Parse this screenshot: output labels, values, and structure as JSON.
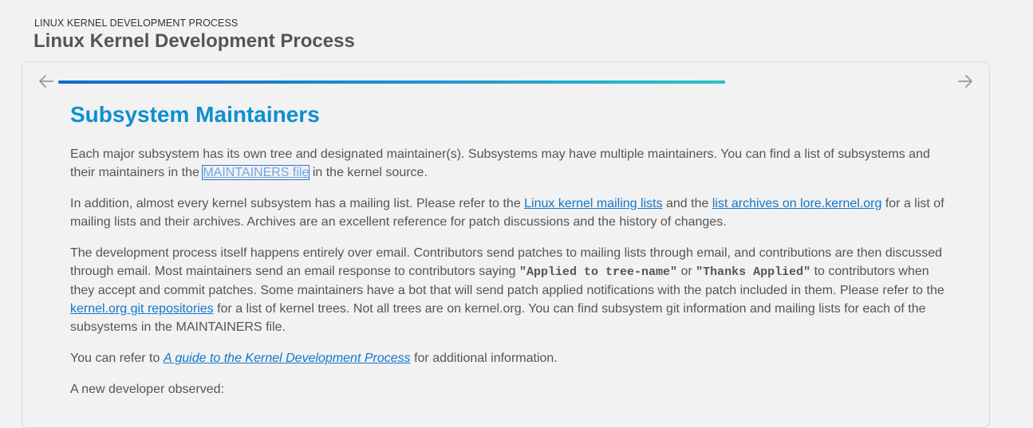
{
  "header": {
    "kicker": "LINUX KERNEL DEVELOPMENT PROCESS",
    "title": "Linux Kernel Development Process"
  },
  "progress": {
    "fraction": 0.85
  },
  "section": {
    "title": "Subsystem Maintainers",
    "p1": {
      "before": "Each major subsystem has its own tree and designated maintainer(s). Subsystems may have multiple maintainers. You can find a list of subsystems and their maintainers in the ",
      "link": "MAINTAINERS file",
      "after": " in the kernel source."
    },
    "p2": {
      "before": "In addition, almost every kernel subsystem has a mailing list. Please refer to the ",
      "link1": "Linux kernel mailing lists",
      "mid": " and the ",
      "link2": "list archives on lore.kernel.org",
      "after": " for a list of mailing lists and their archives. Archives are an excellent reference for patch discussions and the history of changes."
    },
    "p3": {
      "before": "The development process itself happens entirely over email. Contributors send patches to mailing lists through email, and contributions are then discussed through email. Most maintainers send an email response to contributors saying ",
      "code1": "\"Applied to tree-name\"",
      "or": " or ",
      "code2": "\"Thanks Applied\"",
      "mid": " to contributors when they accept and commit patches. Some maintainers have a bot that will send patch applied notifications with the patch included in them. Please refer to the ",
      "link": "kernel.org git repositories",
      "after": " for a list of kernel trees. Not all trees are on kernel.org. You can find subsystem git information and mailing lists for each of the subsystems in the MAINTAINERS file."
    },
    "p4": {
      "before": "You can refer to ",
      "link": "A guide to the Kernel Development Process",
      "after": " for additional information."
    },
    "p5": "A new developer observed:"
  },
  "icons": {
    "prev": "arrow-left-icon",
    "next": "arrow-right-icon"
  }
}
